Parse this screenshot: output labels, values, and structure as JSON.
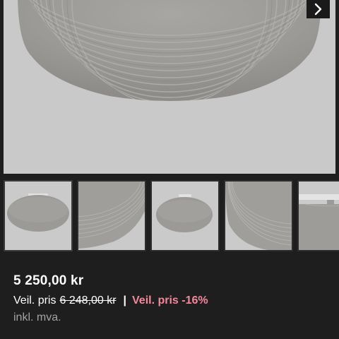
{
  "gallery": {
    "next_icon": "chevron-right-icon",
    "thumbnail_count": 5,
    "active_thumbnail": 1
  },
  "price": {
    "current": "5 250,00 kr",
    "compare_label": "Veil. pris",
    "compare_value": "6 248,00 kr",
    "separator": "|",
    "discount_label": "Veil. pris -16%",
    "vat_note": "inkl. mva."
  },
  "colors": {
    "background": "#1e1e1e",
    "image_background": "#c9c9c9",
    "discount": "#f3889a",
    "muted_text": "#a3a3a3"
  }
}
